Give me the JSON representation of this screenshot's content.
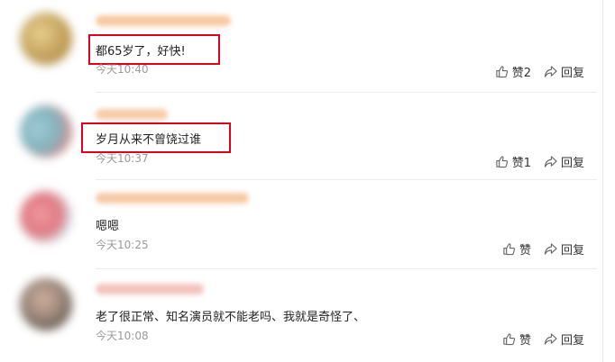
{
  "comments": [
    {
      "text": "都65岁了，好快!",
      "time": "今天10:40",
      "like": "赞2",
      "reply": "回复",
      "colors": {
        "avatar": "#b48a3a",
        "username": "#f4a26a"
      }
    },
    {
      "text": "岁月从来不曾饶过谁",
      "time": "今天10:37",
      "like": "赞1",
      "reply": "回复",
      "colors": {
        "avatar": "#6fa6b3",
        "username": "#f3b07a"
      }
    },
    {
      "text": "嗯嗯",
      "time": "今天10:25",
      "like": "赞",
      "reply": "回复",
      "colors": {
        "avatar": "#d9616a",
        "username": "#f3a86c"
      }
    },
    {
      "text": "老了很正常、知名演员就不能老吗、我就是奇怪了、",
      "time": "今天10:08",
      "like": "赞",
      "reply": "回复",
      "colors": {
        "avatar": "#6c5a4c",
        "username": "#e9a3a0"
      }
    }
  ],
  "icons": {
    "like": "thumbs-up-icon",
    "reply": "share-arrow-icon"
  },
  "highlight_color": "#e0001b"
}
